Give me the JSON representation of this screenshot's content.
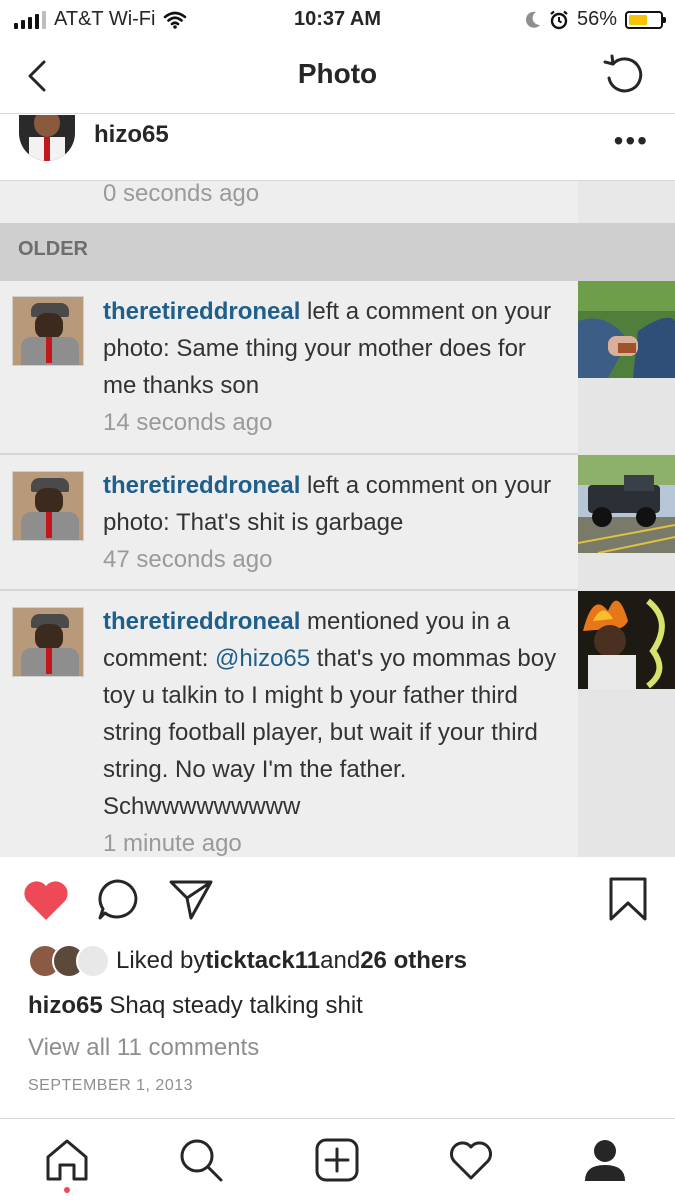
{
  "status_bar": {
    "carrier": "AT&T Wi-Fi",
    "time": "10:37 AM",
    "battery": "56%",
    "battery_level": 0.56
  },
  "nav": {
    "title": "Photo"
  },
  "post": {
    "username": "hizo65",
    "more": "•••",
    "top_cutoff_time": "0 seconds ago",
    "section_header": "OLDER",
    "notifications": [
      {
        "user": "theretireddroneal",
        "action": " left a comment on your photo: ",
        "mention": "",
        "message": "Same thing your mother does for me thanks son",
        "time": "14 seconds ago"
      },
      {
        "user": "theretireddroneal",
        "action": " left a comment on your photo: ",
        "mention": "",
        "message": "That's shit is garbage",
        "time": "47 seconds ago"
      },
      {
        "user": "theretireddroneal",
        "action": " mentioned you in a comment: ",
        "mention": "@hizo65",
        "message": " that's yo mommas boy toy u talkin to I might b your father third string football player, but wait if your third string. No way I'm the father. Schwwwwwwwww",
        "time": "1 minute ago"
      }
    ]
  },
  "likes": {
    "prefix": "Liked by ",
    "user": "ticktack11",
    "middle": " and ",
    "others": "26 others"
  },
  "caption": {
    "user": "hizo65",
    "text": " Shaq steady talking shit"
  },
  "view_comments": "View all 11 comments",
  "date": "SEPTEMBER 1, 2013",
  "colors": {
    "like_red": "#ed4956",
    "link_blue": "#1f5f8b"
  }
}
